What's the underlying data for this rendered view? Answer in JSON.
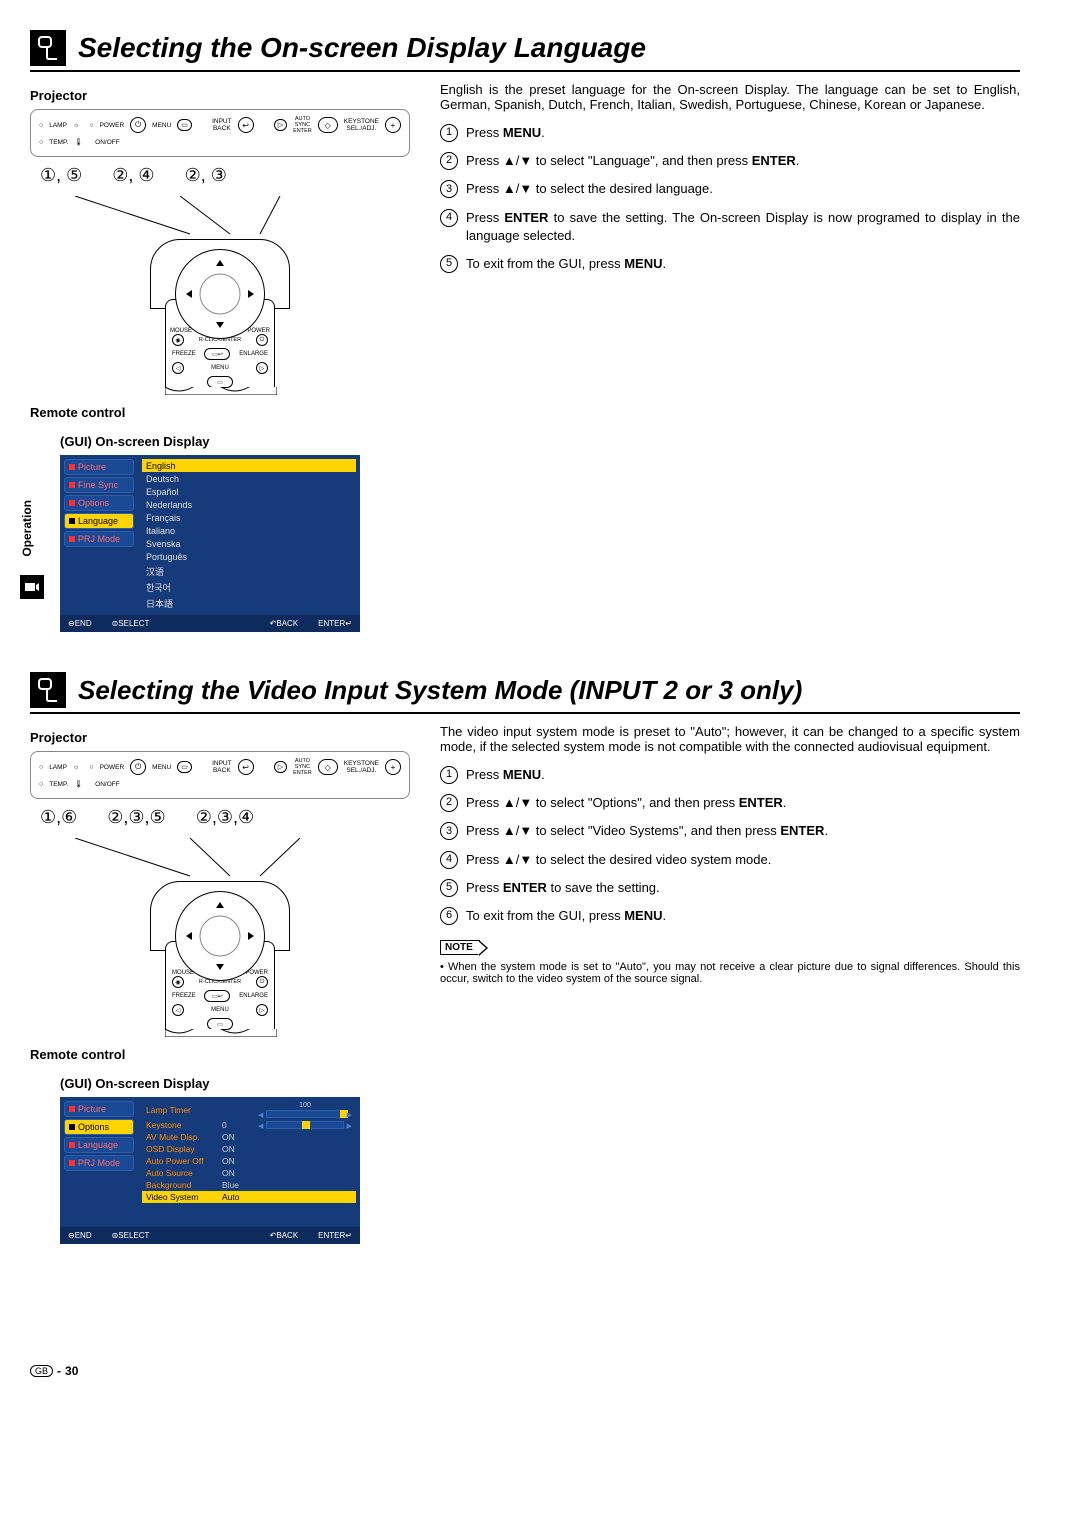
{
  "side_tab": "Operation",
  "page_number": "30",
  "page_prefix": "GB",
  "section1": {
    "title": "Selecting the On-screen Display Language",
    "projector_label": "Projector",
    "remote_label": "Remote control",
    "gui_label": "(GUI) On-screen Display",
    "num_refs": [
      "①, ⑤",
      "②, ④",
      "②, ③"
    ],
    "proj_panel": {
      "lamp": "LAMP",
      "power": "POWER",
      "temp": "TEMP.",
      "onoff": "ON/OFF",
      "menu": "MENU",
      "input": "INPUT",
      "back": "BACK",
      "autosync": "AUTO\nSYNC",
      "enter": "ENTER",
      "keystone": "KEYSTONE",
      "seladj": "SEL./ADJ."
    },
    "remote": {
      "mouse": "MOUSE",
      "power": "POWER",
      "freeze": "FREEZE",
      "enlarge": "ENLARGE",
      "rclick": "R-CLICK/ENTER",
      "menu": "MENU"
    },
    "gui": {
      "sidebar": [
        {
          "label": "Picture",
          "color": "red"
        },
        {
          "label": "Fine Sync",
          "color": "red"
        },
        {
          "label": "Options",
          "color": "red"
        },
        {
          "label": "Language",
          "active": true
        },
        {
          "label": "PRJ Mode",
          "color": "red"
        }
      ],
      "languages": [
        {
          "label": "English",
          "hl": true
        },
        {
          "label": "Deutsch"
        },
        {
          "label": "Español"
        },
        {
          "label": "Nederlands"
        },
        {
          "label": "Français"
        },
        {
          "label": "Italiano"
        },
        {
          "label": "Svenska"
        },
        {
          "label": "Português"
        },
        {
          "label": "汉语"
        },
        {
          "label": "한국어"
        },
        {
          "label": "日本語"
        }
      ],
      "footer": {
        "end": "END",
        "select": "SELECT",
        "back": "BACK",
        "enter": "ENTER"
      }
    },
    "intro": "English is the preset language for the On-screen Display. The language can be set to English, German, Spanish, Dutch, French, Italian, Swedish, Portuguese, Chinese, Korean or Japanese.",
    "steps": [
      {
        "n": "1",
        "html": "Press <b>MENU</b>."
      },
      {
        "n": "2",
        "html": "Press ▲/▼ to select \"Language\", and then press <b>ENTER</b>."
      },
      {
        "n": "3",
        "html": "Press ▲/▼ to select the desired language."
      },
      {
        "n": "4",
        "html": "Press <b>ENTER</b> to save the setting. The On-screen Display is now programed to display in the language selected."
      },
      {
        "n": "5",
        "html": "To exit from the GUI, press <b>MENU</b>."
      }
    ]
  },
  "section2": {
    "title": "Selecting the Video Input System Mode (INPUT 2 or 3 only)",
    "projector_label": "Projector",
    "remote_label": "Remote control",
    "gui_label": "(GUI) On-screen Display",
    "num_refs": [
      "①,⑥",
      "②,③,⑤",
      "②,③,④"
    ],
    "gui": {
      "sidebar": [
        {
          "label": "Picture",
          "color": "red"
        },
        {
          "label": "Options",
          "active": true
        },
        {
          "label": "Language",
          "color": "red"
        },
        {
          "label": "PRJ Mode",
          "color": "red"
        }
      ],
      "rows": [
        {
          "label": "Lamp Timer",
          "val": "",
          "slider": 100,
          "sliderMax": 100,
          "sliderLabel": "100"
        },
        {
          "label": "Keystone",
          "val": "0",
          "slider": 50,
          "sliderMax": 100
        },
        {
          "label": "AV Mute Disp.",
          "val": "ON"
        },
        {
          "label": "OSD Display",
          "val": "ON"
        },
        {
          "label": "Auto Power Off",
          "val": "ON"
        },
        {
          "label": "Auto Source",
          "val": "ON"
        },
        {
          "label": "Background",
          "val": "Blue"
        },
        {
          "label": "Video System",
          "val": "Auto",
          "hl": true
        }
      ],
      "footer": {
        "end": "END",
        "select": "SELECT",
        "back": "BACK",
        "enter": "ENTER"
      }
    },
    "intro": "The video input system mode is preset to \"Auto\"; however, it can be changed to a specific system mode, if the selected system mode is not compatible with the connected audiovisual equipment.",
    "steps": [
      {
        "n": "1",
        "html": "Press <b>MENU</b>."
      },
      {
        "n": "2",
        "html": "Press ▲/▼ to select \"Options\", and then press <b>ENTER</b>."
      },
      {
        "n": "3",
        "html": "Press ▲/▼ to select \"Video Systems\", and then press <b>ENTER</b>."
      },
      {
        "n": "4",
        "html": "Press ▲/▼ to select the desired video system mode."
      },
      {
        "n": "5",
        "html": "Press <b>ENTER</b> to save the setting."
      },
      {
        "n": "6",
        "html": "To exit from the GUI, press <b>MENU</b>."
      }
    ],
    "note_label": "NOTE",
    "notes": [
      "When the system mode is set to \"Auto\", you may not receive a clear picture due to signal differences. Should this occur, switch to the video system of the source signal."
    ]
  }
}
